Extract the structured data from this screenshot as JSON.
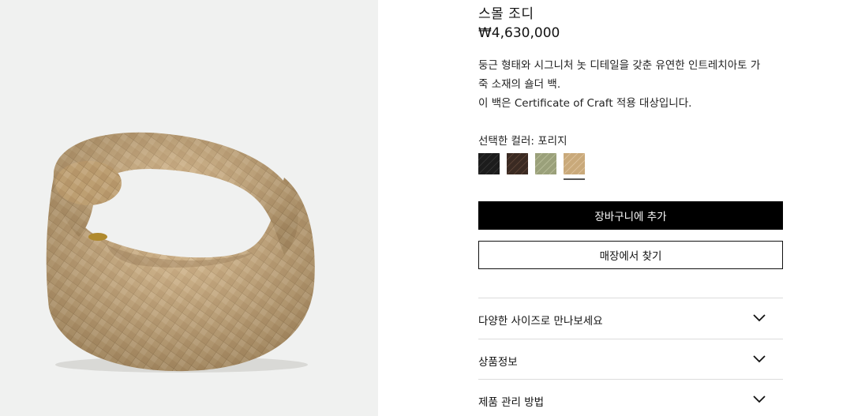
{
  "product": {
    "title": "스몰 조디",
    "price": "₩4,630,000",
    "description_lines": [
      "둥근 형태와 시그니처 놋 디테일을 갖춘 유연한 인트레치아토 가",
      "죽 소재의 숄더 백.",
      "이 백은 Certificate of Craft 적용 대상입니다."
    ],
    "image_alt": "product-image-small-jodie-porridge"
  },
  "color": {
    "label": "선택한 컬러: 포리지",
    "swatches": [
      {
        "name": "black",
        "color": "#1c1c1c",
        "selected": false
      },
      {
        "name": "brown",
        "color": "#3a2a22",
        "selected": false
      },
      {
        "name": "green",
        "color": "#9aa07a",
        "selected": false
      },
      {
        "name": "porridge",
        "color": "#c9a97a",
        "selected": true
      }
    ]
  },
  "actions": {
    "add_to_cart": "장바구니에 추가",
    "find_in_store": "매장에서 찾기"
  },
  "accordion": [
    {
      "label": "다양한 사이즈로 만나보세요"
    },
    {
      "label": "상품정보"
    },
    {
      "label": "제품 관리 방법"
    }
  ],
  "colors": {
    "gallery_bg": "#f0f1f0",
    "bag": "#c9a97a",
    "primary_button": "#000000",
    "divider": "#dcdcdc"
  }
}
